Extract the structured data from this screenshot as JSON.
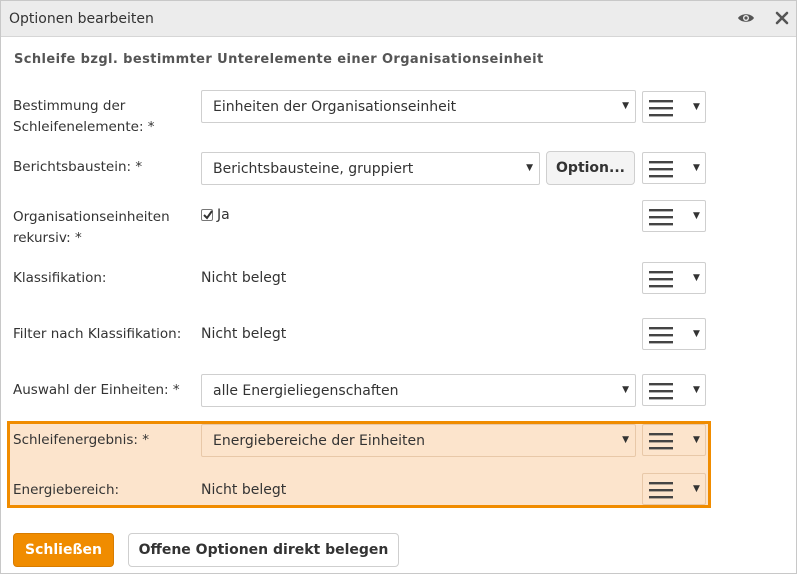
{
  "window": {
    "title": "Optionen bearbeiten"
  },
  "heading": "Schleife bzgl. bestimmter Unterelemente einer Organisationseinheit",
  "fields": {
    "bestimmung": {
      "label_line1": "Bestimmung der",
      "label_line2": "Schleifenelemente: *",
      "value": "Einheiten der Organisationseinheit"
    },
    "berichtsbaustein": {
      "label": "Berichtsbaustein: *",
      "value": "Berichtsbausteine, gruppiert",
      "option_button": "Option..."
    },
    "rekursiv": {
      "label_line1": "Organisationseinheiten",
      "label_line2": "rekursiv: *",
      "checkbox_label": "Ja",
      "checked": true
    },
    "klassifikation": {
      "label": "Klassifikation:",
      "value": "Nicht belegt"
    },
    "filter": {
      "label": "Filter nach Klassifikation:",
      "value": "Nicht belegt"
    },
    "auswahl": {
      "label": "Auswahl der Einheiten: *",
      "value": "alle Energieliegenschaften"
    },
    "schleifenergebnis": {
      "label": "Schleifenergebnis: *",
      "value": "Energiebereiche der Einheiten"
    },
    "energiebereich": {
      "label": "Energiebereich:",
      "value": "Nicht belegt"
    }
  },
  "footer": {
    "close_button": "Schließen",
    "open_options_button": "Offene Optionen direkt belegen"
  },
  "colors": {
    "accent": "#f08c00",
    "highlight_bg": "#fce4cc",
    "titlebar_bg": "#ececec"
  },
  "icons": {
    "window_view": "eye-icon",
    "window_close": "close-icon",
    "row_menu": "hamburger-menu-icon",
    "dropdown": "caret-down-icon"
  }
}
